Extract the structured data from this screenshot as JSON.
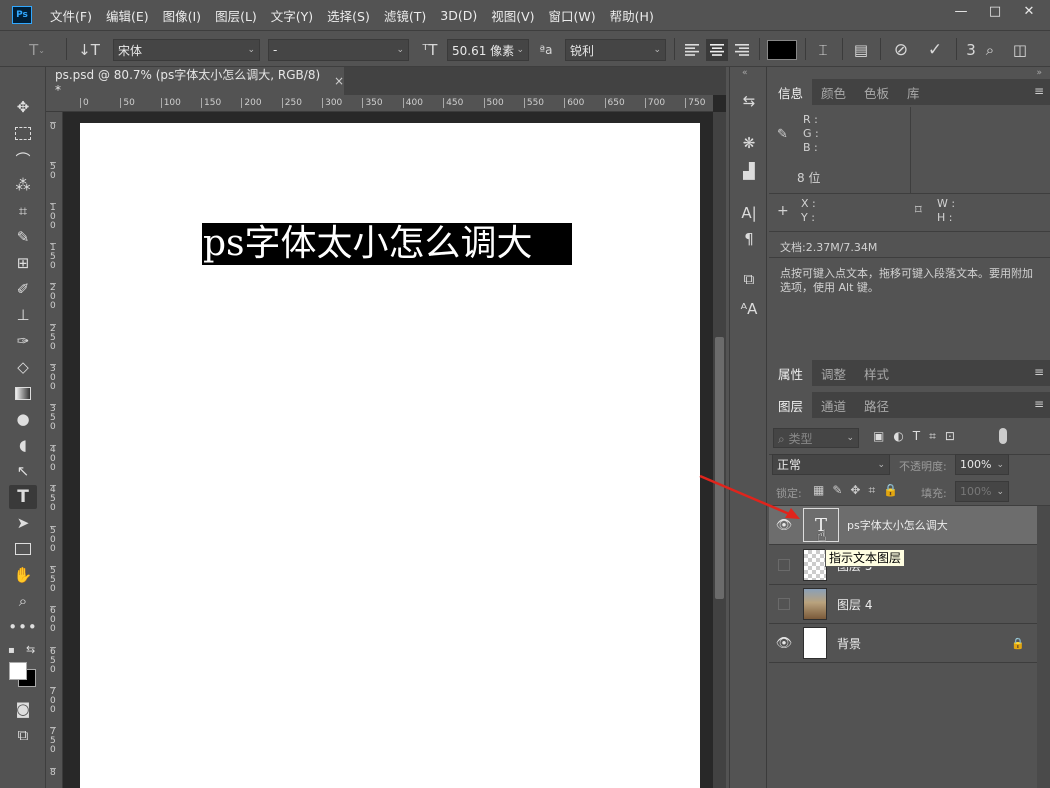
{
  "app": {
    "logo": "Ps"
  },
  "menu": [
    "文件(F)",
    "编辑(E)",
    "图像(I)",
    "图层(L)",
    "文字(Y)",
    "选择(S)",
    "滤镜(T)",
    "3D(D)",
    "视图(V)",
    "窗口(W)",
    "帮助(H)"
  ],
  "window_controls": {
    "minimize": "—",
    "maximize": "□",
    "close": "✕"
  },
  "options": {
    "font_family": "宋体",
    "font_style": "-",
    "font_size": "50.61 像素",
    "aa_label": "ªa",
    "antialias": "锐利",
    "color_swatch": "#000000"
  },
  "document": {
    "tab_title": "ps.psd @ 80.7% (ps字体太小怎么调大, RGB/8) *",
    "tab_close": "×",
    "canvas_text": "ps字体太小怎么调大",
    "ruler_h": [
      "0",
      "50",
      "100",
      "150",
      "200",
      "250",
      "300",
      "350",
      "400",
      "450",
      "500",
      "550",
      "600",
      "650",
      "700",
      "750"
    ],
    "ruler_v": [
      "0",
      "5\n0",
      "1\n0\n0",
      "1\n5\n0",
      "2\n0\n0",
      "2\n5\n0",
      "3\n0\n0",
      "3\n5\n0",
      "4\n0\n0",
      "4\n5\n0",
      "5\n0\n0",
      "5\n5\n0",
      "6\n0\n0",
      "6\n5\n0",
      "7\n0\n0",
      "7\n5\n0",
      "8"
    ]
  },
  "info_panel": {
    "tabs": [
      "信息",
      "颜色",
      "色板",
      "库"
    ],
    "r": "R :",
    "g": "G :",
    "b": "B :",
    "bits": "8 位",
    "x": "X :",
    "y": "Y :",
    "w": "W :",
    "h": "H :",
    "doc_size": "文档:2.37M/7.34M",
    "hint": "点按可键入点文本，拖移可键入段落文本。要用附加选项，使用 Alt 键。"
  },
  "props_panel": {
    "tabs": [
      "属性",
      "调整",
      "样式"
    ]
  },
  "layers_panel": {
    "tabs": [
      "图层",
      "通道",
      "路径"
    ],
    "filter_label": "类型",
    "blend_mode": "正常",
    "opacity_label": "不透明度:",
    "opacity": "100%",
    "lock_label": "锁定:",
    "fill_label": "填充:",
    "fill": "100%",
    "layers": [
      {
        "name": "ps字体太小怎么调大",
        "visible": true,
        "thumb": "T"
      },
      {
        "name": "图层 5",
        "visible": false
      },
      {
        "name": "图层 4",
        "visible": false
      },
      {
        "name": "背景",
        "visible": true,
        "locked": true
      }
    ],
    "tooltip": "指示文本图层"
  }
}
